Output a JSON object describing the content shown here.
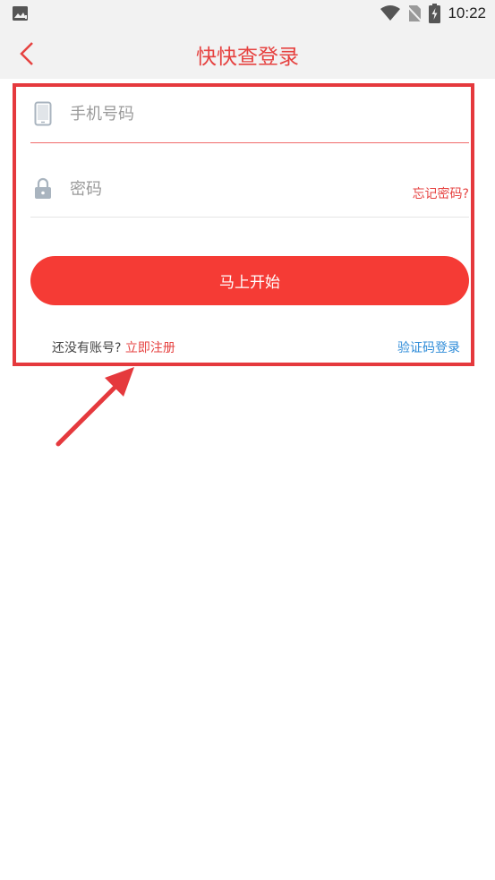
{
  "status_bar": {
    "time": "10:22",
    "icons": [
      "image-notification-icon",
      "wifi-icon",
      "no-sim-icon",
      "battery-icon"
    ]
  },
  "app_bar": {
    "title": "快快查登录",
    "back_icon": "chevron-left-icon"
  },
  "form": {
    "phone": {
      "placeholder": "手机号码",
      "value": "",
      "icon": "phone-icon"
    },
    "password": {
      "placeholder": "密码",
      "value": "",
      "icon": "lock-icon"
    },
    "forgot_label": "忘记密码?",
    "start_label": "马上开始",
    "no_account_label": "还没有账号?",
    "register_label": "立即注册",
    "code_login_label": "验证码登录"
  },
  "colors": {
    "accent": "#e64240",
    "button": "#f53b35",
    "link_blue": "#2f8cd8",
    "highlight_box": "#e5393d"
  }
}
